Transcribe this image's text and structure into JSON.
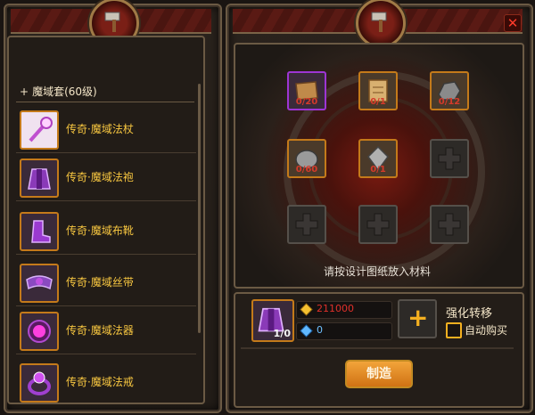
{
  "left_panel": {
    "group_label": "魔域套(60级)",
    "group_toggle": "+",
    "items": [
      {
        "label": "传奇·魔域法杖",
        "icon": "staff-icon"
      },
      {
        "label": "传奇·魔域法袍",
        "icon": "robe-icon"
      },
      {
        "label": "传奇·魔域布靴",
        "icon": "boots-icon"
      },
      {
        "label": "传奇·魔域丝带",
        "icon": "belt-icon"
      },
      {
        "label": "传奇·魔域法器",
        "icon": "orb-icon"
      },
      {
        "label": "传奇·魔域法戒",
        "icon": "ring-icon"
      }
    ]
  },
  "right_panel": {
    "close": "✕",
    "materials": [
      {
        "count": "0/20",
        "icon": "scroll-icon",
        "rarity": "purple"
      },
      {
        "count": "0/1",
        "icon": "blueprint-icon",
        "rarity": "orange"
      },
      {
        "count": "0/12",
        "icon": "ore-icon",
        "rarity": "orange"
      },
      {
        "count": "0/60",
        "icon": "stone-icon",
        "rarity": "orange"
      },
      {
        "count": "0/1",
        "icon": "crystal-icon",
        "rarity": "orange"
      },
      {
        "count": "",
        "icon": "empty-slot-icon",
        "rarity": "empty"
      },
      {
        "count": "",
        "icon": "empty-slot-icon",
        "rarity": "empty"
      },
      {
        "count": "",
        "icon": "empty-slot-icon",
        "rarity": "empty"
      },
      {
        "count": "",
        "icon": "empty-slot-icon",
        "rarity": "empty"
      }
    ],
    "hint": "请按设计图纸放入材料",
    "result_ratio": "1/0",
    "gold_cost": "211000",
    "diamond_cost": "0",
    "add_symbol": "+",
    "transfer_label": "强化转移",
    "auto_buy_label": "自动购买",
    "make_button": "制造"
  },
  "colors": {
    "gold_text": "#f7c640",
    "cost_red": "#e0302a",
    "cost_blue": "#6ec0ff",
    "accent_orange": "#d07214"
  }
}
